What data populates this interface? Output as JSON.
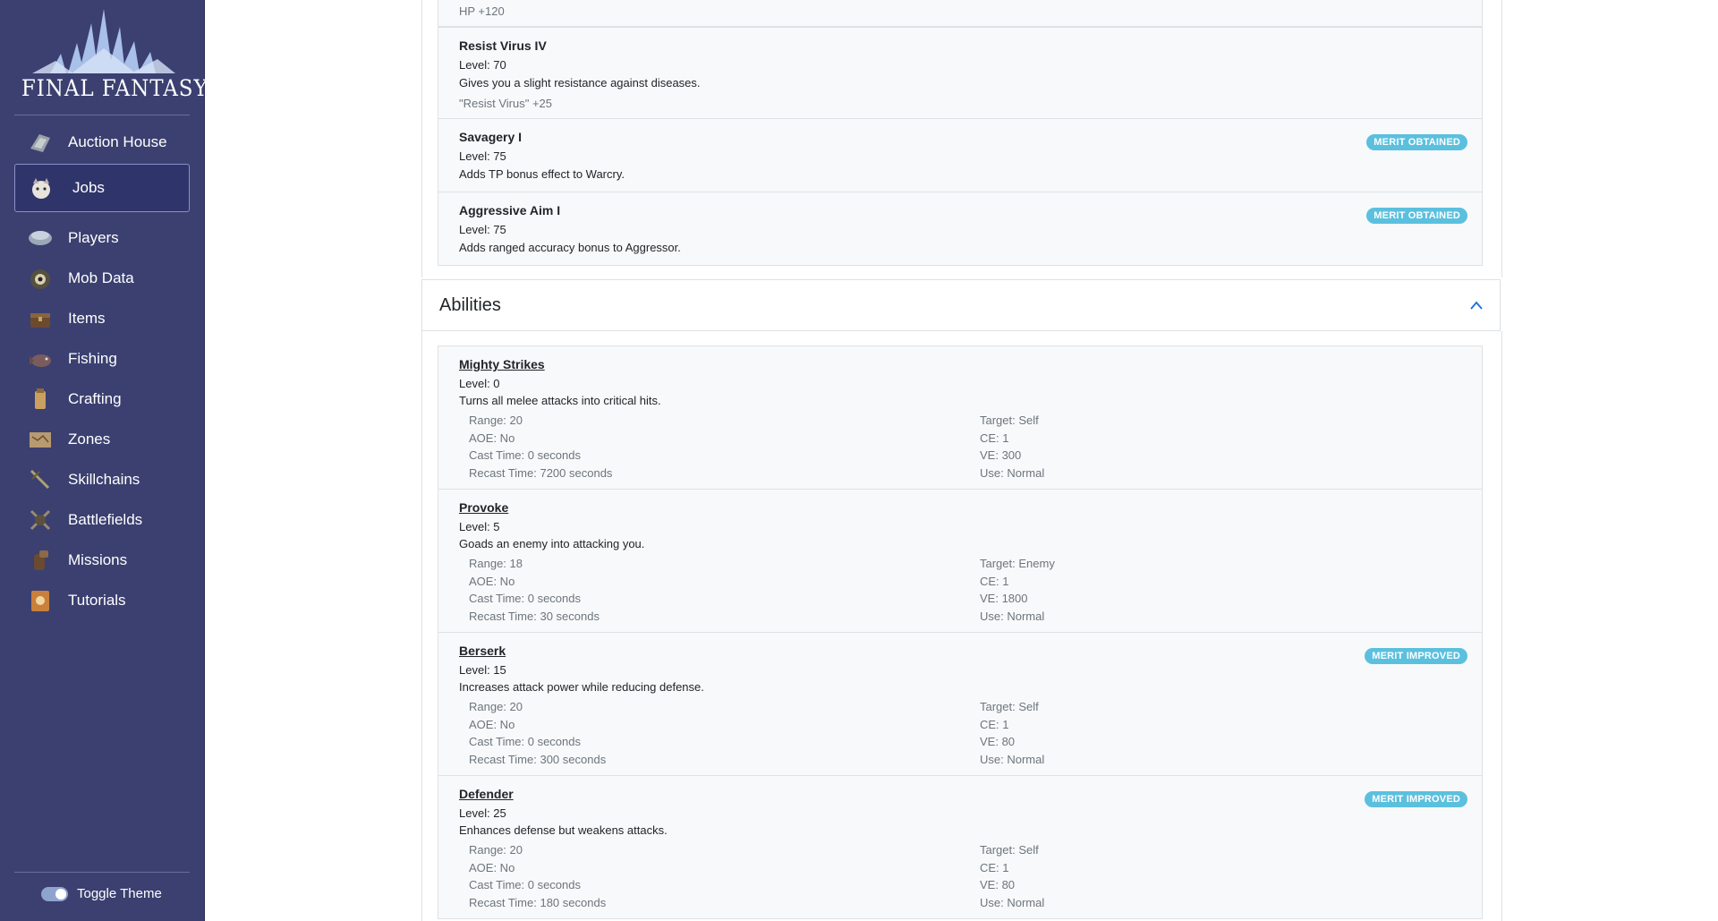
{
  "sidebar": {
    "logo_text": "FINAL FANTASY XI",
    "items": [
      {
        "label": "Auction House",
        "icon": "auction-house-icon"
      },
      {
        "label": "Jobs",
        "icon": "jobs-moogle-icon",
        "active": true
      },
      {
        "label": "Players",
        "icon": "players-helmet-icon"
      },
      {
        "label": "Mob Data",
        "icon": "mob-data-icon"
      },
      {
        "label": "Items",
        "icon": "items-chest-icon"
      },
      {
        "label": "Fishing",
        "icon": "fishing-icon"
      },
      {
        "label": "Crafting",
        "icon": "crafting-icon"
      },
      {
        "label": "Zones",
        "icon": "zones-map-icon"
      },
      {
        "label": "Skillchains",
        "icon": "skillchains-sword-icon"
      },
      {
        "label": "Battlefields",
        "icon": "battlefields-icon"
      },
      {
        "label": "Missions",
        "icon": "missions-icon"
      },
      {
        "label": "Tutorials",
        "icon": "tutorials-book-icon"
      }
    ],
    "toggle_theme": "Toggle Theme"
  },
  "merits": {
    "top_stat": "HP +120",
    "items": [
      {
        "name": "Resist Virus IV",
        "level": "Level: 70",
        "desc": "Gives you a slight resistance against diseases.",
        "stat": "\"Resist Virus\" +25"
      },
      {
        "name": "Savagery I",
        "level": "Level: 75",
        "desc": "Adds TP bonus effect to Warcry.",
        "badge": "MERIT OBTAINED"
      },
      {
        "name": "Aggressive Aim I",
        "level": "Level: 75",
        "desc": "Adds ranged accuracy bonus to Aggressor.",
        "badge": "MERIT OBTAINED"
      }
    ]
  },
  "abilities": {
    "title": "Abilities",
    "collapse_icon": "chevron-up-icon",
    "items": [
      {
        "name": "Mighty Strikes",
        "level": "Level: 0",
        "desc": "Turns all melee attacks into critical hits.",
        "range": "Range: 20",
        "aoe": "AOE: No",
        "cast": "Cast Time: 0 seconds",
        "recast": "Recast Time: 7200 seconds",
        "target": "Target: Self",
        "ce": "CE: 1",
        "ve": "VE: 300",
        "use": "Use: Normal"
      },
      {
        "name": "Provoke",
        "level": "Level: 5",
        "desc": "Goads an enemy into attacking you.",
        "range": "Range: 18",
        "aoe": "AOE: No",
        "cast": "Cast Time: 0 seconds",
        "recast": "Recast Time: 30 seconds",
        "target": "Target: Enemy",
        "ce": "CE: 1",
        "ve": "VE: 1800",
        "use": "Use: Normal"
      },
      {
        "name": "Berserk",
        "level": "Level: 15",
        "desc": "Increases attack power while reducing defense.",
        "range": "Range: 20",
        "aoe": "AOE: No",
        "cast": "Cast Time: 0 seconds",
        "recast": "Recast Time: 300 seconds",
        "target": "Target: Self",
        "ce": "CE: 1",
        "ve": "VE: 80",
        "use": "Use: Normal",
        "badge": "MERIT IMPROVED"
      },
      {
        "name": "Defender",
        "level": "Level: 25",
        "desc": "Enhances defense but weakens attacks.",
        "range": "Range: 20",
        "aoe": "AOE: No",
        "cast": "Cast Time: 0 seconds",
        "recast": "Recast Time: 180 seconds",
        "target": "Target: Self",
        "ce": "CE: 1",
        "ve": "VE: 80",
        "use": "Use: Normal",
        "badge": "MERIT IMPROVED"
      }
    ]
  }
}
